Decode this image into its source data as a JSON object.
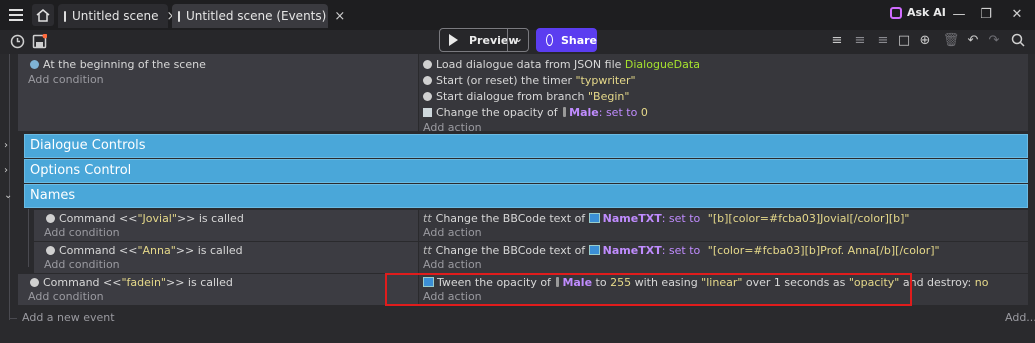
{
  "titlebar": {
    "tabs": [
      {
        "label": "Untitled scene",
        "close": "×"
      },
      {
        "label": "Untitled scene (Events)",
        "close": "×"
      }
    ],
    "ask_ai": "Ask AI",
    "icons": [
      "menu-icon",
      "home-icon",
      "scene-icon",
      "events-icon",
      "minimize-icon",
      "restore-icon",
      "close-icon"
    ]
  },
  "toolbar": {
    "preview_label": "Preview",
    "share_label": "Share",
    "accent": "#5b3df0"
  },
  "events": [
    {
      "condition": "At the beginning of the scene",
      "add_condition": "Add condition",
      "actions": [
        {
          "pre": "Load dialogue data from JSON file ",
          "value": "DialogueData"
        },
        {
          "pre": "Start (or reset) the timer ",
          "value": "\"typwriter\""
        },
        {
          "pre": "Start dialogue from branch ",
          "value": "\"Begin\""
        },
        {
          "pre": "Change the opacity of ",
          "obj": "Male",
          "op": ": set to ",
          "value": "0"
        }
      ],
      "add_action": "Add action"
    }
  ],
  "groups": [
    {
      "label": "Dialogue Controls"
    },
    {
      "label": "Options Control"
    },
    {
      "label": "Names"
    }
  ],
  "name_events": [
    {
      "cond_pre": "Command <<",
      "cond_str": "\"Jovial\"",
      "cond_post": ">> is called",
      "add_condition": "Add condition",
      "act_pre": "Change the BBCode text of ",
      "act_obj": "NameTXT",
      "act_op": ": set to ",
      "act_val": "\"[b][color=#fcba03]Jovial[/color][b]\"",
      "add_action": "Add action"
    },
    {
      "cond_pre": "Command <<",
      "cond_str": "\"Anna\"",
      "cond_post": ">> is called",
      "add_condition": "Add condition",
      "act_pre": "Change the BBCode text of ",
      "act_obj": "NameTXT",
      "act_op": ": set to ",
      "act_val": "\"[color=#fcba03][b]Prof. Anna[/b][/color]\"",
      "add_action": "Add action"
    }
  ],
  "fadein_event": {
    "cond_pre": "Command <<",
    "cond_str": "\"fadein\"",
    "cond_post": ">> is called",
    "add_condition": "Add condition",
    "t1": "Tween the opacity of ",
    "obj": "Male",
    "t2": " to ",
    "v1": "255",
    "t3": " with easing ",
    "v2": "\"linear\"",
    "t4": " over 1 seconds as ",
    "v3": "\"opacity\"",
    "t5": " and destroy: ",
    "v4": "no",
    "add_action": "Add action"
  },
  "footer": {
    "add_event": "Add a new event",
    "add_more": "Add..."
  }
}
